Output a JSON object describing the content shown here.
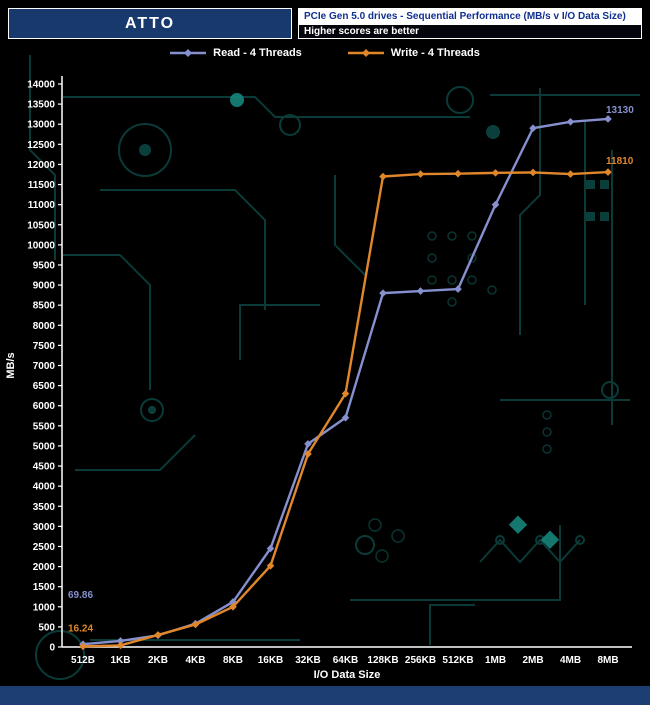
{
  "header": {
    "brand": "ATTO",
    "title": "PCIe Gen 5.0 drives - Sequential Performance (MB/s v I/O Data Size)",
    "subtitle": "Higher scores are better"
  },
  "legend": {
    "items": [
      {
        "label": "Read - 4 Threads",
        "color": "#8690cf"
      },
      {
        "label": "Write - 4 Threads",
        "color": "#e0872b"
      }
    ]
  },
  "chart_data": {
    "type": "line",
    "x": [
      "512B",
      "1KB",
      "2KB",
      "4KB",
      "8KB",
      "16KB",
      "32KB",
      "64KB",
      "128KB",
      "256KB",
      "512KB",
      "1MB",
      "2MB",
      "4MB",
      "8MB"
    ],
    "series": [
      {
        "name": "Read - 4 Threads",
        "color": "#8690cf",
        "values": [
          69.86,
          150,
          290,
          580,
          1120,
          2450,
          5050,
          5700,
          8800,
          8850,
          8900,
          11000,
          12900,
          13060,
          13130
        ]
      },
      {
        "name": "Write - 4 Threads",
        "color": "#e0872b",
        "values": [
          16.24,
          40,
          300,
          560,
          1000,
          2020,
          4800,
          6300,
          11700,
          11760,
          11770,
          11790,
          11800,
          11760,
          11810
        ]
      }
    ],
    "annotations": [
      {
        "text": "69.86",
        "series": 0,
        "index": 0,
        "dx": -15,
        "dy": -46
      },
      {
        "text": "16.24",
        "series": 1,
        "index": 0,
        "dx": -15,
        "dy": -15
      },
      {
        "text": "13130",
        "series": 0,
        "index": 14,
        "dx": -2,
        "dy": -6
      },
      {
        "text": "11810",
        "series": 1,
        "index": 14,
        "dx": -2,
        "dy": -8
      }
    ],
    "xlabel": "I/O Data Size",
    "ylabel": "MB/s",
    "ylim": [
      0,
      14000
    ],
    "ytick_step": 500,
    "grid": false,
    "legend_position": "top"
  }
}
